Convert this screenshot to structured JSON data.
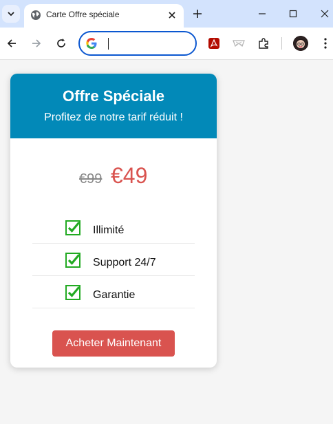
{
  "browser": {
    "tab": {
      "title": "Carte Offre spéciale",
      "favicon": "globe-icon"
    },
    "omnibox": {
      "value": "",
      "placeholder": ""
    },
    "accent_color": "#0b57d0",
    "tabbar_color": "#d3e3fd"
  },
  "card": {
    "header_color": "#0289b8",
    "title": "Offre Spéciale",
    "subtitle": "Profitez de notre tarif réduit !",
    "old_price": "€99",
    "new_price": "€49",
    "price_color": "#d9534f",
    "features": [
      {
        "label": "Illimité",
        "icon": "checkbox-checked-icon"
      },
      {
        "label": "Support 24/7",
        "icon": "checkbox-checked-icon"
      },
      {
        "label": "Garantie",
        "icon": "checkbox-checked-icon"
      }
    ],
    "button_label": "Acheter Maintenant",
    "button_color": "#d9534f"
  }
}
